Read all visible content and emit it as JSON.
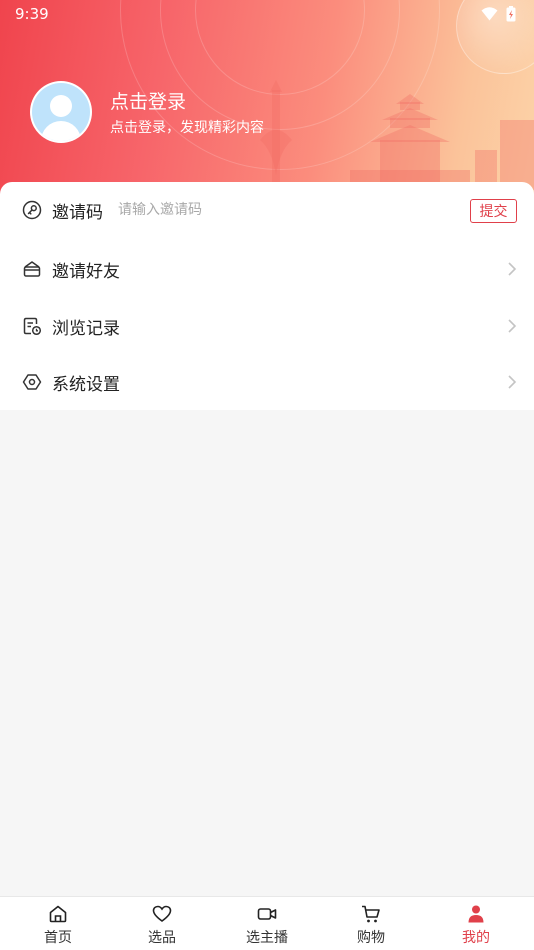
{
  "status_bar": {
    "time": "9:39"
  },
  "profile": {
    "title": "点击登录",
    "subtitle": "点击登录，发现精彩内容"
  },
  "invite": {
    "label": "邀请码",
    "placeholder": "请输入邀请码",
    "submit_label": "提交"
  },
  "menu": {
    "items": [
      {
        "label": "邀请好友",
        "icon": "invite-friends-icon"
      },
      {
        "label": "浏览记录",
        "icon": "browse-history-icon"
      },
      {
        "label": "系统设置",
        "icon": "settings-icon"
      }
    ]
  },
  "bottom_nav": {
    "items": [
      {
        "label": "首页",
        "icon": "home-icon"
      },
      {
        "label": "选品",
        "icon": "heart-icon"
      },
      {
        "label": "选主播",
        "icon": "video-icon"
      },
      {
        "label": "购物",
        "icon": "cart-icon"
      },
      {
        "label": "我的",
        "icon": "profile-icon"
      }
    ],
    "active_index": 4
  },
  "colors": {
    "accent": "#e0404a",
    "banner_start": "#f0444d",
    "banner_end": "#fcd3a8",
    "avatar_bg": "#bfe3fb"
  }
}
